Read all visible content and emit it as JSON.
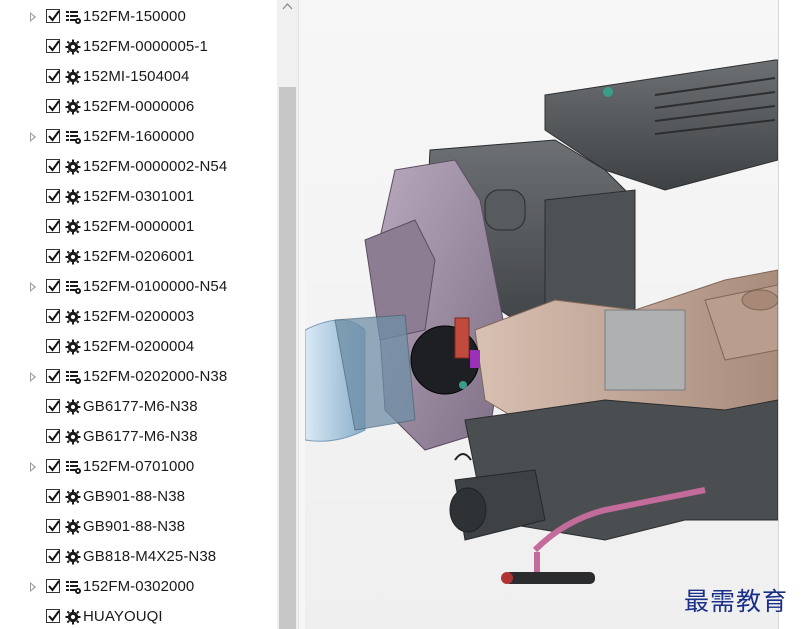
{
  "tree": {
    "items": [
      {
        "label": "152FM-150000",
        "type": "assembly",
        "expandable": true,
        "checked": true
      },
      {
        "label": "152FM-0000005-1",
        "type": "part",
        "expandable": false,
        "checked": true
      },
      {
        "label": "152MI-1504004",
        "type": "part",
        "expandable": false,
        "checked": true
      },
      {
        "label": "152FM-0000006",
        "type": "part",
        "expandable": false,
        "checked": true
      },
      {
        "label": "152FM-1600000",
        "type": "assembly",
        "expandable": true,
        "checked": true
      },
      {
        "label": "152FM-0000002-N54",
        "type": "part",
        "expandable": false,
        "checked": true
      },
      {
        "label": "152FM-0301001",
        "type": "part",
        "expandable": false,
        "checked": true
      },
      {
        "label": "152FM-0000001",
        "type": "part",
        "expandable": false,
        "checked": true
      },
      {
        "label": "152FM-0206001",
        "type": "part",
        "expandable": false,
        "checked": true
      },
      {
        "label": "152FM-0100000-N54",
        "type": "assembly",
        "expandable": true,
        "checked": true
      },
      {
        "label": "152FM-0200003",
        "type": "part",
        "expandable": false,
        "checked": true
      },
      {
        "label": "152FM-0200004",
        "type": "part",
        "expandable": false,
        "checked": true
      },
      {
        "label": "152FM-0202000-N38",
        "type": "assembly",
        "expandable": true,
        "checked": true
      },
      {
        "label": "GB6177-M6-N38",
        "type": "part",
        "expandable": false,
        "checked": true
      },
      {
        "label": "GB6177-M6-N38",
        "type": "part",
        "expandable": false,
        "checked": true
      },
      {
        "label": "152FM-0701000",
        "type": "assembly",
        "expandable": true,
        "checked": true
      },
      {
        "label": "GB901-88-N38",
        "type": "part",
        "expandable": false,
        "checked": true
      },
      {
        "label": "GB901-88-N38",
        "type": "part",
        "expandable": false,
        "checked": true
      },
      {
        "label": "GB818-M4X25-N38",
        "type": "part",
        "expandable": false,
        "checked": true
      },
      {
        "label": "152FM-0302000",
        "type": "assembly",
        "expandable": true,
        "checked": true
      },
      {
        "label": "HUAYOUQI",
        "type": "part",
        "expandable": false,
        "checked": true
      }
    ]
  },
  "icons": {
    "expander": "triangle-right-icon",
    "checkbox": "checkmark-icon",
    "part": "gear-icon",
    "assembly": "assembly-list-icon",
    "scroll_up": "chevron-up-icon"
  },
  "colors": {
    "selection_text": "#1a1a1a",
    "scrollbar_track": "#f0f0f0",
    "scrollbar_thumb": "#c7c7c7",
    "model_gray": "#5a5d60",
    "model_purple": "#9a8aa0",
    "model_tan": "#c9b1a2",
    "model_blue": "#a8c8e0",
    "watermark": "#1a2f8a"
  },
  "watermark": {
    "text": "最需教育"
  }
}
